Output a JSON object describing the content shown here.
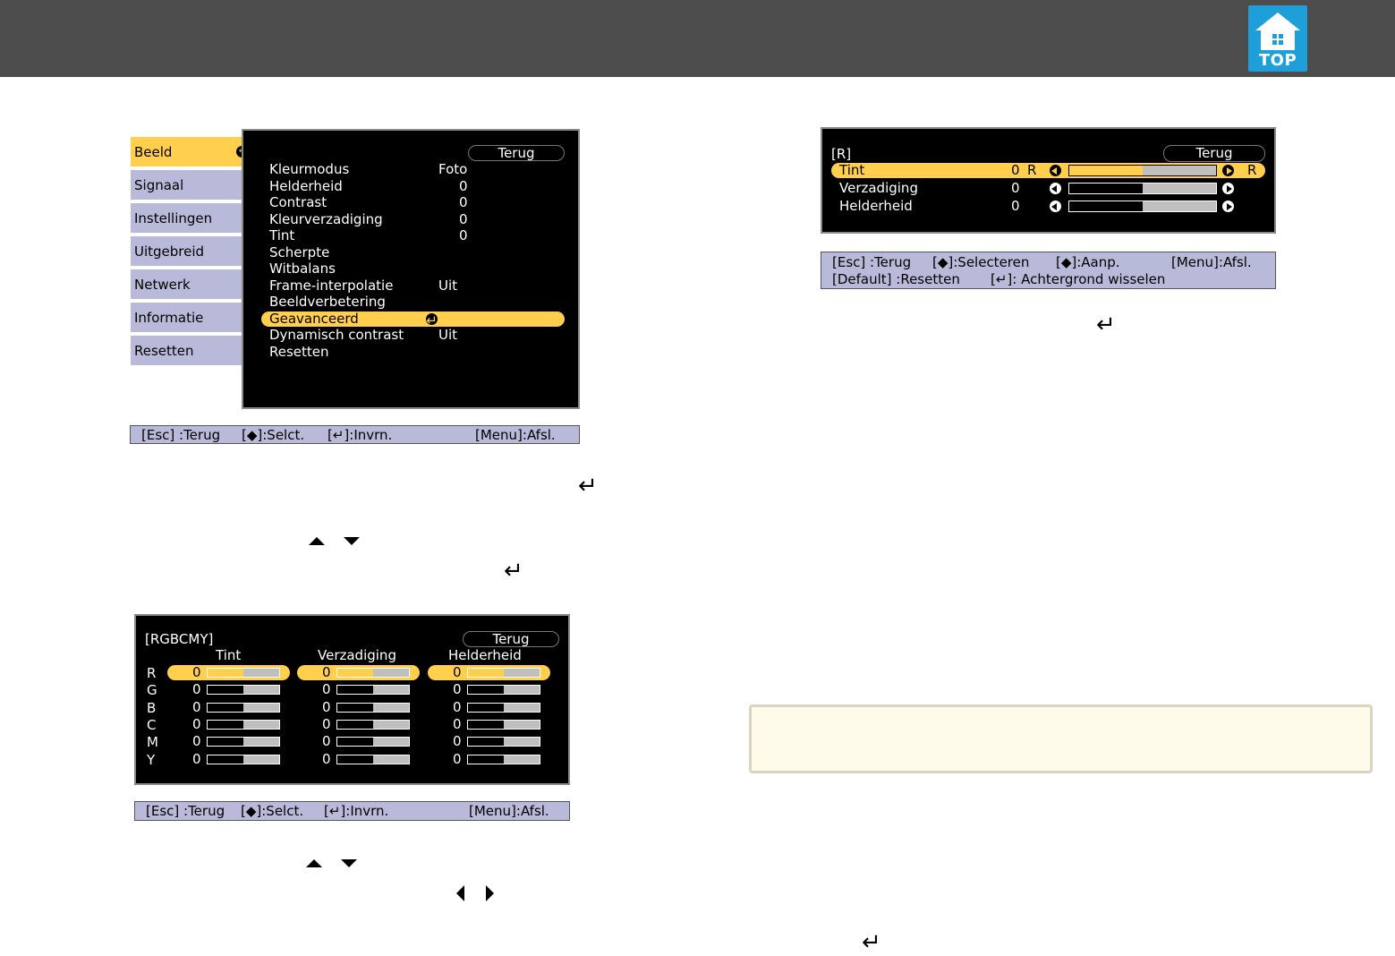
{
  "top_button": {
    "label": "TOP",
    "icon": "top-home-icon"
  },
  "menu1": {
    "tabs": [
      "Beeld",
      "Signaal",
      "Instellingen",
      "Uitgebreid",
      "Netwerk",
      "Informatie",
      "Resetten"
    ],
    "back": "Terug",
    "items": [
      {
        "label": "Kleurmodus",
        "value": "Foto"
      },
      {
        "label": "Helderheid",
        "value": "0"
      },
      {
        "label": "Contrast",
        "value": "0"
      },
      {
        "label": "Kleurverzadiging",
        "value": "0"
      },
      {
        "label": "Tint",
        "value": "0"
      },
      {
        "label": "Scherpte",
        "value": ""
      },
      {
        "label": "Witbalans",
        "value": ""
      },
      {
        "label": "Frame-interpolatie",
        "value": "Uit"
      },
      {
        "label": "Beeldverbetering",
        "value": ""
      },
      {
        "label": "Geavanceerd",
        "value": ""
      },
      {
        "label": "Dynamisch contrast",
        "value": "Uit"
      },
      {
        "label": "Resetten",
        "value": ""
      }
    ],
    "help": {
      "esc": "[Esc] :Terug",
      "sel": "[◆]:Selct.",
      "enter": "[↵]:Invrn.",
      "menu": "[Menu]:Afsl."
    }
  },
  "menu2": {
    "title": "[RGBCMY]",
    "back": "Terug",
    "columns": [
      "Tint",
      "Verzadiging",
      "Helderheid"
    ],
    "rows": [
      "R",
      "G",
      "B",
      "C",
      "M",
      "Y"
    ],
    "values": [
      [
        "0",
        "0",
        "0"
      ],
      [
        "0",
        "0",
        "0"
      ],
      [
        "0",
        "0",
        "0"
      ],
      [
        "0",
        "0",
        "0"
      ],
      [
        "0",
        "0",
        "0"
      ],
      [
        "0",
        "0",
        "0"
      ]
    ],
    "slider_level": 0.5,
    "help": {
      "esc": "[Esc] :Terug",
      "sel": "[◆]:Selct.",
      "enter": "[↵]:Invrn.",
      "menu": "[Menu]:Afsl."
    }
  },
  "menu3": {
    "title": "[R]",
    "back": "Terug",
    "items": [
      {
        "label": "Tint",
        "value": "0",
        "left": "R",
        "right": "R"
      },
      {
        "label": "Verzadiging",
        "value": "0",
        "left": "",
        "right": ""
      },
      {
        "label": "Helderheid",
        "value": "0",
        "left": "",
        "right": ""
      }
    ],
    "slider_level": 0.5,
    "help": {
      "line1a": "[Esc] :Terug",
      "line1b": "[◆]:Selecteren",
      "line1c": "[◆]:Aanp.",
      "line1d": "[Menu]:Afsl.",
      "line2a": "[Default] :Resetten",
      "line2b": "[↵]: Achtergrond wisselen"
    }
  }
}
